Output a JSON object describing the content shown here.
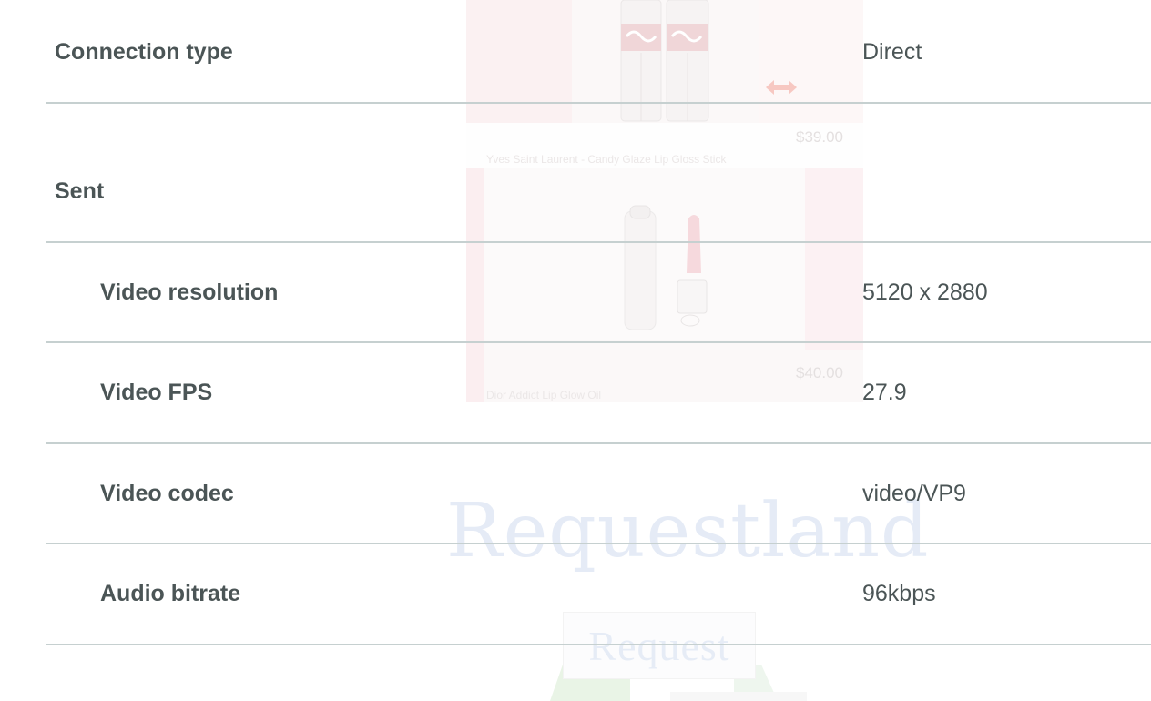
{
  "stats": {
    "connection_type": {
      "label": "Connection type",
      "value": "Direct"
    },
    "sent_heading": "Sent",
    "video_resolution": {
      "label": "Video resolution",
      "value": "5120 x 2880"
    },
    "video_fps": {
      "label": "Video FPS",
      "value": "27.9"
    },
    "video_codec": {
      "label": "Video codec",
      "value": "video/VP9"
    },
    "audio_bitrate": {
      "label": "Audio bitrate",
      "value": "96kbps"
    }
  },
  "background": {
    "products": [
      {
        "title": "Yves Saint Laurent - Candy Glaze Lip Gloss Stick",
        "price": "$39.00"
      },
      {
        "title": "Dior Addict Lip Glow Oil",
        "price": "$40.00"
      }
    ],
    "watermark": "Requestland",
    "logo_text": "Request"
  },
  "colors": {
    "text": "#4b5556",
    "separator": "#c6d0d0",
    "watermark": "#e5ebf6"
  }
}
